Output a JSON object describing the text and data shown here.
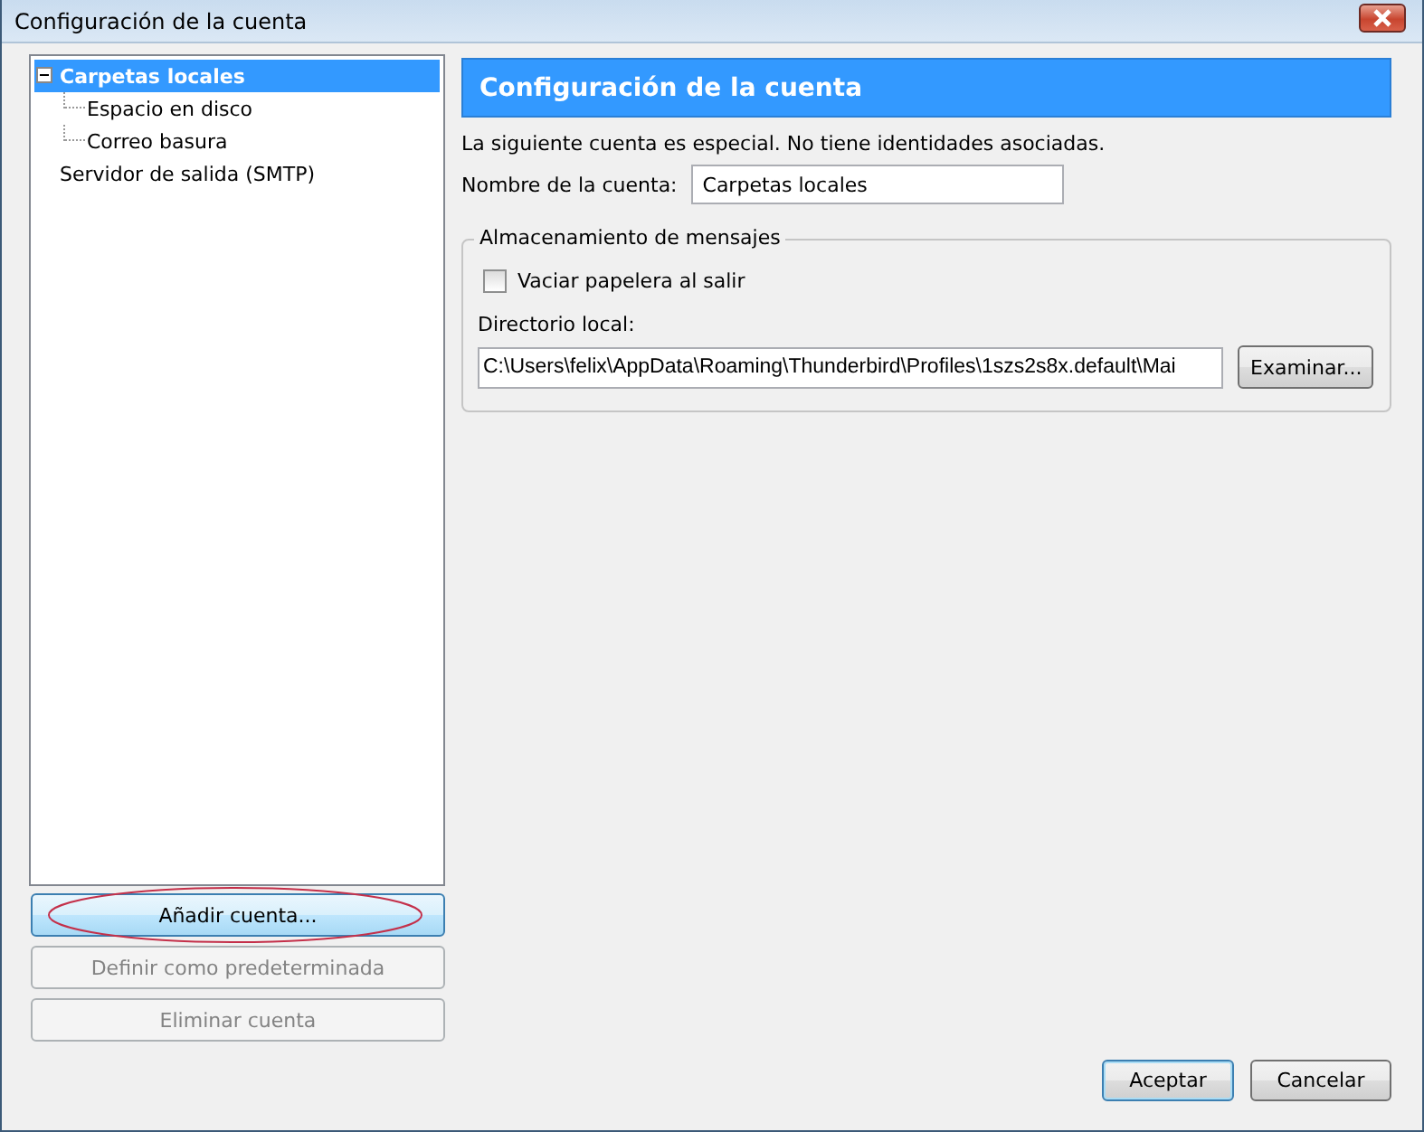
{
  "window": {
    "title": "Configuración de la cuenta"
  },
  "tree": [
    {
      "label": "Carpetas locales",
      "selected": true,
      "expanded": true,
      "children": [
        {
          "label": "Espacio en disco",
          "selected": false
        },
        {
          "label": "Correo basura",
          "selected": false
        }
      ]
    },
    {
      "label": "Servidor de salida (SMTP)",
      "selected": false
    }
  ],
  "account_buttons": [
    {
      "label": "Añadir cuenta...",
      "disabled": false,
      "circled": true
    },
    {
      "label": "Definir como predeterminada",
      "disabled": true,
      "circled": false
    },
    {
      "label": "Eliminar cuenta",
      "disabled": true,
      "circled": false
    }
  ],
  "panel": {
    "title": "Configuración de la cuenta",
    "note": "La siguiente cuenta es especial. No tiene identidades asociadas.",
    "name_label": "Nombre de la cuenta:",
    "name_value": "Carpetas locales",
    "group": {
      "legend": "Almacenamiento de mensajes",
      "checkbox": {
        "label": "Vaciar papelera al salir",
        "checked": false
      },
      "dir_label": "Directorio local:",
      "dir_value": "C:\\Users\\felix\\AppData\\Roaming\\Thunderbird\\Profiles\\1szs2s8x.default\\Mai",
      "browse": "Examinar..."
    }
  },
  "dialog_buttons": [
    {
      "label": "Aceptar",
      "default": true
    },
    {
      "label": "Cancelar",
      "default": false
    }
  ]
}
